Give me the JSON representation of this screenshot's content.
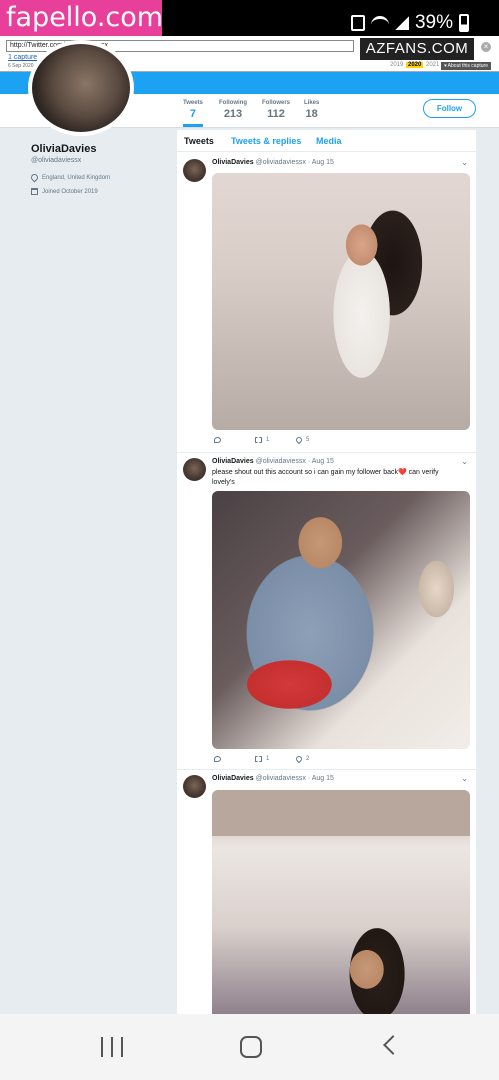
{
  "watermark": {
    "left": "fapello.com",
    "right": "AZFANS.COM"
  },
  "status_bar": {
    "battery_percent": "39%"
  },
  "wayback": {
    "url": "http://Twitter.com/oliviadaviessx",
    "capture_count": "1 capture",
    "capture_date": "6 Sep 2020",
    "years": [
      "2019",
      "2020",
      "2021"
    ],
    "active_year": "2020",
    "month_day": "06",
    "about": "▾ About this capture"
  },
  "profile": {
    "name": "OliviaDavies",
    "handle": "@oliviadaviessx",
    "location": "England, United Kingdom",
    "joined": "Joined October 2019",
    "stats": [
      {
        "label": "Tweets",
        "value": "7"
      },
      {
        "label": "Following",
        "value": "213"
      },
      {
        "label": "Followers",
        "value": "112"
      },
      {
        "label": "Likes",
        "value": "18"
      }
    ],
    "follow_label": "Follow"
  },
  "timeline": {
    "tabs": [
      "Tweets",
      "Tweets & replies",
      "Media"
    ],
    "tweets": [
      {
        "name": "OliviaDavies",
        "handle": "@oliviadaviessx",
        "date": "· Aug 15",
        "text": "",
        "retweets": "1",
        "likes": "5"
      },
      {
        "name": "OliviaDavies",
        "handle": "@oliviadaviessx",
        "date": "· Aug 15",
        "text": "please shout out this account so i can gain my follower back❤️ can verify lovely's",
        "retweets": "1",
        "likes": "2"
      },
      {
        "name": "OliviaDavies",
        "handle": "@oliviadaviessx",
        "date": "· Aug 15",
        "text": "",
        "retweets": "",
        "likes": ""
      }
    ]
  }
}
